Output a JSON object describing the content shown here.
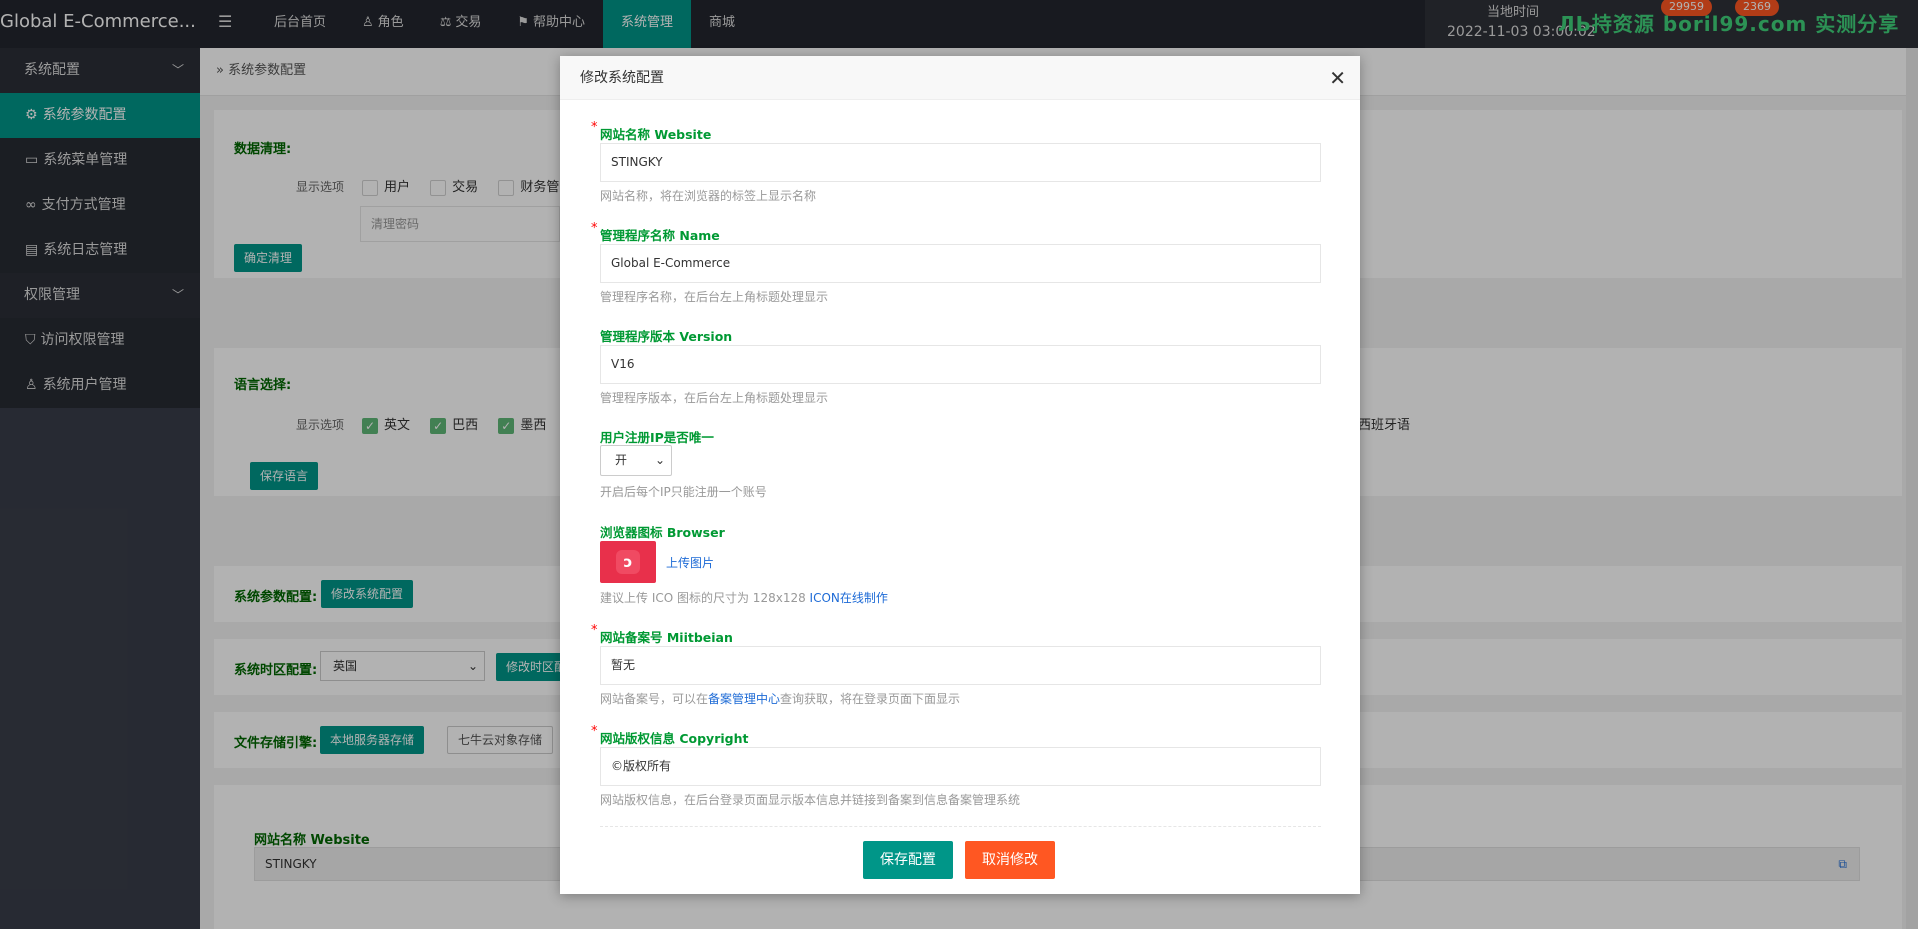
{
  "app": {
    "title": "Global E-Commerce..."
  },
  "topnav": {
    "items": [
      {
        "label": "后台首页",
        "icon": ""
      },
      {
        "label": "角色",
        "icon": "user-icon"
      },
      {
        "label": "交易",
        "icon": "scale-icon"
      },
      {
        "label": "帮助中心",
        "icon": "flag-icon"
      },
      {
        "label": "系统管理",
        "icon": ""
      },
      {
        "label": "商城",
        "icon": ""
      }
    ],
    "active_index": 4
  },
  "topright": {
    "time_label": "当地时间",
    "time_value": "2022-11-03 03:00:02",
    "badge1": "29959",
    "badge2": "2369",
    "watermark": "ЛЬ持资源 boril99.com 实测分享"
  },
  "sidebar": {
    "groups": [
      {
        "label": "系统配置",
        "items": [
          {
            "label": "系统参数配置",
            "icon": "gear-icon",
            "active": true
          },
          {
            "label": "系统菜单管理",
            "icon": "window-icon"
          },
          {
            "label": "支付方式管理",
            "icon": "link-icon"
          },
          {
            "label": "系统日志管理",
            "icon": "doc-icon"
          }
        ]
      },
      {
        "label": "权限管理",
        "items": [
          {
            "label": "访问权限管理",
            "icon": "shield-icon"
          },
          {
            "label": "系统用户管理",
            "icon": "user-icon"
          }
        ]
      }
    ]
  },
  "breadcrumb": {
    "label": "系统参数配置"
  },
  "bg": {
    "data_clean_label": "数据清理:",
    "display_options_label": "显示选项",
    "clean_options": [
      "用户",
      "交易",
      "财务管"
    ],
    "clean_password_placeholder": "清理密码",
    "confirm_clean": "确定清理",
    "lang_label": "语言选择:",
    "lang_options": [
      "英文",
      "巴西",
      "墨西"
    ],
    "lang_tail": "西班牙语",
    "save_lang": "保存语言",
    "sys_param_label": "系统参数配置:",
    "modify_sys_config": "修改系统配置",
    "timezone_label": "系统时区配置:",
    "timezone_value": "英国",
    "modify_timezone": "修改时区配",
    "storage_label": "文件存储引擎:",
    "storage_local": "本地服务器存储",
    "storage_qiniu": "七牛云对象存储",
    "bottom_website_label": "网站名称 Website",
    "bottom_website_value": "STINGKY"
  },
  "modal": {
    "title": "修改系统配置",
    "website_label": "网站名称 Website",
    "website_value": "STINGKY",
    "website_help": "网站名称，将在浏览器的标签上显示名称",
    "name_label": "管理程序名称 Name",
    "name_value": "Global E-Commerce",
    "name_help": "管理程序名称，在后台左上角标题处理显示",
    "version_label": "管理程序版本 Version",
    "version_value": "V16",
    "version_help": "管理程序版本，在后台左上角标题处理显示",
    "ip_label": "用户注册IP是否唯一",
    "ip_value": "开",
    "ip_help": "开启后每个IP只能注册一个账号",
    "browser_label": "浏览器图标 Browser",
    "upload_label": "上传图片",
    "browser_help": "建议上传 ICO 图标的尺寸为 128x128 ",
    "browser_help_link": "ICON在线制作",
    "miit_label": "网站备案号 Miitbeian",
    "miit_value": "暂无",
    "miit_help_pre": "网站备案号，可以在",
    "miit_help_link": "备案管理中心",
    "miit_help_post": "查询获取，将在登录页面下面显示",
    "copyright_label": "网站版权信息 Copyright",
    "copyright_value": "©版权所有",
    "copyright_help": "网站版权信息，在后台登录页面显示版本信息并链接到备案到信息备案管理系统",
    "save_button": "保存配置",
    "cancel_button": "取消修改",
    "required_mark": "*"
  },
  "colors": {
    "accent": "#009688",
    "danger": "#ff5722",
    "label_green": "#009933",
    "sidebar_bg": "#393d49",
    "topbar_bg": "#23262e"
  }
}
